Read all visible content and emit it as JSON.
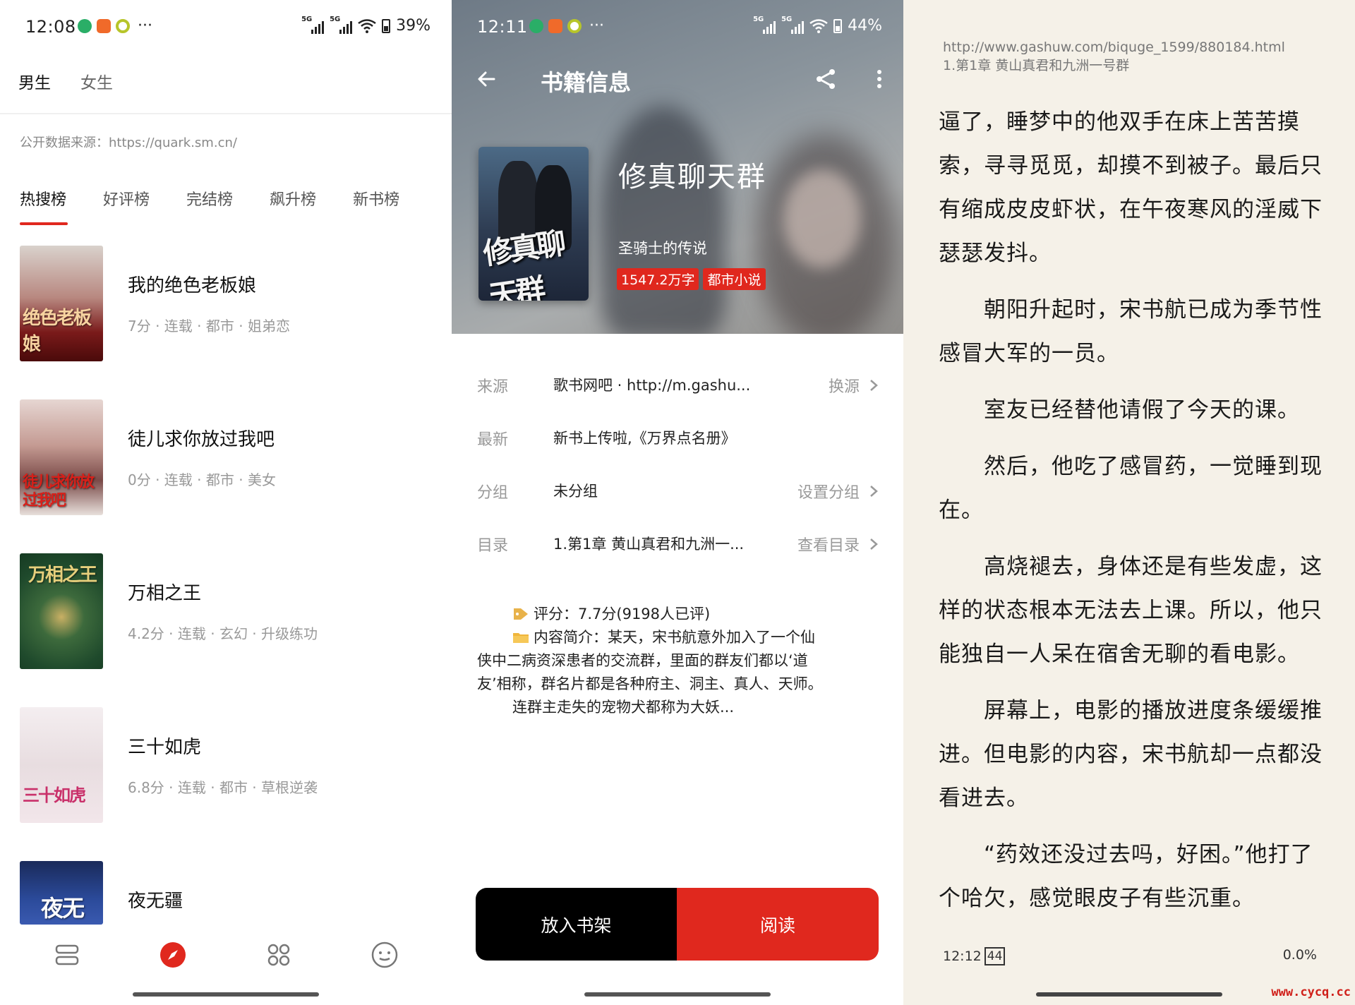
{
  "panel1": {
    "status": {
      "time": "12:08",
      "battery": "39%"
    },
    "gender_tabs": [
      "男生",
      "女生"
    ],
    "source_note": "公开数据来源：https://quark.sm.cn/",
    "rank_tabs": [
      "热搜榜",
      "好评榜",
      "完结榜",
      "飙升榜",
      "新书榜"
    ],
    "books": [
      {
        "title": "我的绝色老板娘",
        "meta": "7分 · 连载 · 都市 · 姐弟恋",
        "cover_text": "绝色老板娘"
      },
      {
        "title": "徒儿求你放过我吧",
        "meta": "0分 · 连载 · 都市 · 美女",
        "cover_text": "徒儿求你放过我吧"
      },
      {
        "title": "万相之王",
        "meta": "4.2分 · 连载 · 玄幻 · 升级练功",
        "cover_text": "万相之王"
      },
      {
        "title": "三十如虎",
        "meta": "6.8分 · 连载 · 都市 · 草根逆袭",
        "cover_text": "三十如虎"
      },
      {
        "title": "夜无疆",
        "meta": "",
        "cover_text": "夜无"
      }
    ]
  },
  "panel2": {
    "status": {
      "time": "12:11",
      "battery": "44%"
    },
    "title": "书籍信息",
    "book": {
      "title": "修真聊天群",
      "author": "圣骑士的传说",
      "word_count": "1547.2万字",
      "category": "都市小说",
      "cover_text": "修真聊天群"
    },
    "rows": [
      {
        "label": "来源",
        "value": "歌书网吧 · http://m.gashu...",
        "action": "换源"
      },
      {
        "label": "最新",
        "value": "新书上传啦,《万界点名册》",
        "action": ""
      },
      {
        "label": "分组",
        "value": "未分组",
        "action": "设置分组"
      },
      {
        "label": "目录",
        "value": "1.第1章 黄山真君和九洲一...",
        "action": "查看目录"
      }
    ],
    "rating": "评分：7.7分(9198人已评)",
    "intro_label": "内容简介：某天，宋书航意外加入了一个仙",
    "intro_lines": [
      "侠中二病资深患者的交流群，里面的群友们都以‘道",
      "友’相称，群名片都是各种府主、洞主、真人、天师。"
    ],
    "intro_last": "连群主走失的宠物犬都称为大妖...",
    "shelf_button": "放入书架",
    "read_button": "阅读"
  },
  "panel3": {
    "url": "http://www.gashuw.com/biquge_1599/880184.html",
    "chapter": "1.第1章 黄山真君和九洲一号群",
    "paragraphs": [
      {
        "text": "逼了，睡梦中的他双手在床上苦苦摸索，寻寻觅觅，却摸不到被子。最后只有缩成皮皮虾状，在午夜寒风的淫威下瑟瑟发抖。",
        "indent": false
      },
      {
        "text": "朝阳升起时，宋书航已成为季节性感冒大军的一员。",
        "indent": true
      },
      {
        "text": "室友已经替他请假了今天的课。",
        "indent": true
      },
      {
        "text": "然后，他吃了感冒药，一觉睡到现在。",
        "indent": true
      },
      {
        "text": "高烧褪去，身体还是有些发虚，这样的状态根本无法去上课。所以，他只能独自一人呆在宿舍无聊的看电影。",
        "indent": true
      },
      {
        "text": "屏幕上，电影的播放进度条缓缓推进。但电影的内容，宋书航却一点都没看进去。",
        "indent": true
      },
      {
        "text": "“药效还没过去吗，好困。”他打了个哈欠，感觉眼皮子有些沉重。",
        "indent": true
      }
    ],
    "footer_time": "12:12",
    "footer_battery": "44",
    "progress": "0.0%",
    "watermark": "www.cycq.cc"
  },
  "colors": {
    "accent": "#e0281e",
    "reader_bg": "#f5f1e8"
  }
}
